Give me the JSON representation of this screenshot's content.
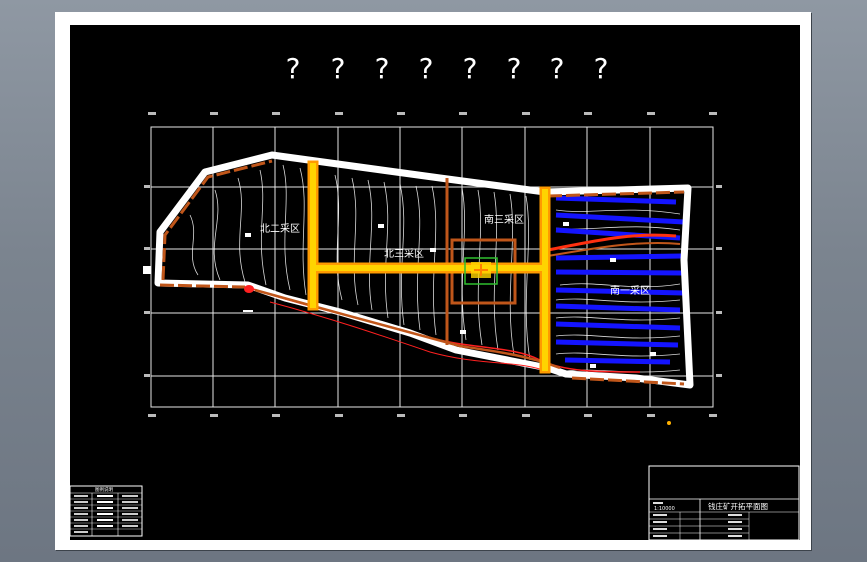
{
  "title_marks": [
    "?",
    "?",
    "?",
    "?",
    "?",
    "?",
    "?",
    "?"
  ],
  "zones": {
    "north": "北二采区",
    "center_north": "北三采区",
    "south_upper": "南三采区",
    "south_lower": "南一采区"
  },
  "title_block": {
    "drawing_title": "钱庄矿开拓平面图",
    "scale": "1:10000"
  },
  "legend": {
    "heading": "图例说明"
  },
  "colors": {
    "background": "#000000",
    "grid": "#ffffff",
    "roadway": "#ffd400",
    "roadway_glow": "#ff9a00",
    "boundary": "#ffffff",
    "boundary_inner": "#c0561a",
    "workings": "#1010ff",
    "fault": "#ff2020"
  }
}
